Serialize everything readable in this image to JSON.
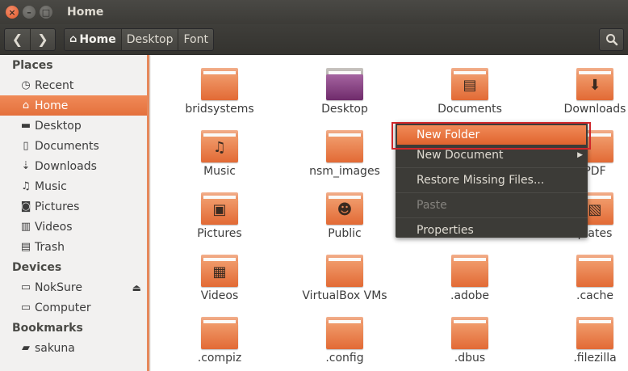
{
  "window": {
    "title": "Home"
  },
  "toolbar": {
    "breadcrumbs": [
      "Home",
      "Desktop",
      "Font"
    ]
  },
  "sidebar": {
    "sections": [
      {
        "label": "Places",
        "items": [
          {
            "label": "Recent",
            "icon": "clock-icon"
          },
          {
            "label": "Home",
            "icon": "home-icon",
            "selected": true
          },
          {
            "label": "Desktop",
            "icon": "desktop-icon"
          },
          {
            "label": "Documents",
            "icon": "document-icon"
          },
          {
            "label": "Downloads",
            "icon": "download-icon"
          },
          {
            "label": "Music",
            "icon": "music-icon"
          },
          {
            "label": "Pictures",
            "icon": "camera-icon"
          },
          {
            "label": "Videos",
            "icon": "video-icon"
          },
          {
            "label": "Trash",
            "icon": "trash-icon"
          }
        ]
      },
      {
        "label": "Devices",
        "items": [
          {
            "label": "NokSure",
            "icon": "drive-icon",
            "eject": true
          },
          {
            "label": "Computer",
            "icon": "computer-icon"
          }
        ]
      },
      {
        "label": "Bookmarks",
        "items": [
          {
            "label": "sakuna",
            "icon": "folder-icon"
          }
        ]
      }
    ]
  },
  "files": [
    {
      "label": "bridsystems",
      "emblem": ""
    },
    {
      "label": "Desktop",
      "emblem": "desktop"
    },
    {
      "label": "Documents",
      "emblem": "document"
    },
    {
      "label": "Downloads",
      "emblem": "download"
    },
    {
      "label": "Music",
      "emblem": "music"
    },
    {
      "label": "nsm_images",
      "emblem": ""
    },
    {
      "label": "",
      "emblem": ""
    },
    {
      "label": "PDF",
      "emblem": ""
    },
    {
      "label": "Pictures",
      "emblem": "picture"
    },
    {
      "label": "Public",
      "emblem": "person"
    },
    {
      "label": "",
      "emblem": ""
    },
    {
      "label": "plates",
      "emblem": "template"
    },
    {
      "label": "Videos",
      "emblem": "video"
    },
    {
      "label": "VirtualBox VMs",
      "emblem": ""
    },
    {
      "label": ".adobe",
      "emblem": ""
    },
    {
      "label": ".cache",
      "emblem": ""
    },
    {
      "label": ".compiz",
      "emblem": ""
    },
    {
      "label": ".config",
      "emblem": ""
    },
    {
      "label": ".dbus",
      "emblem": ""
    },
    {
      "label": ".filezilla",
      "emblem": ""
    }
  ],
  "context_menu": {
    "items": [
      {
        "label": "New Folder",
        "highlighted": true
      },
      {
        "label": "New Document",
        "submenu": true
      },
      {
        "separator": true
      },
      {
        "label": "Restore Missing Files..."
      },
      {
        "separator": true
      },
      {
        "label": "Paste",
        "disabled": true
      },
      {
        "separator": true
      },
      {
        "label": "Properties"
      }
    ]
  },
  "colors": {
    "accent": "#e4703c",
    "highlight_box": "#d0272b",
    "titlebar": "#3c3b37"
  }
}
